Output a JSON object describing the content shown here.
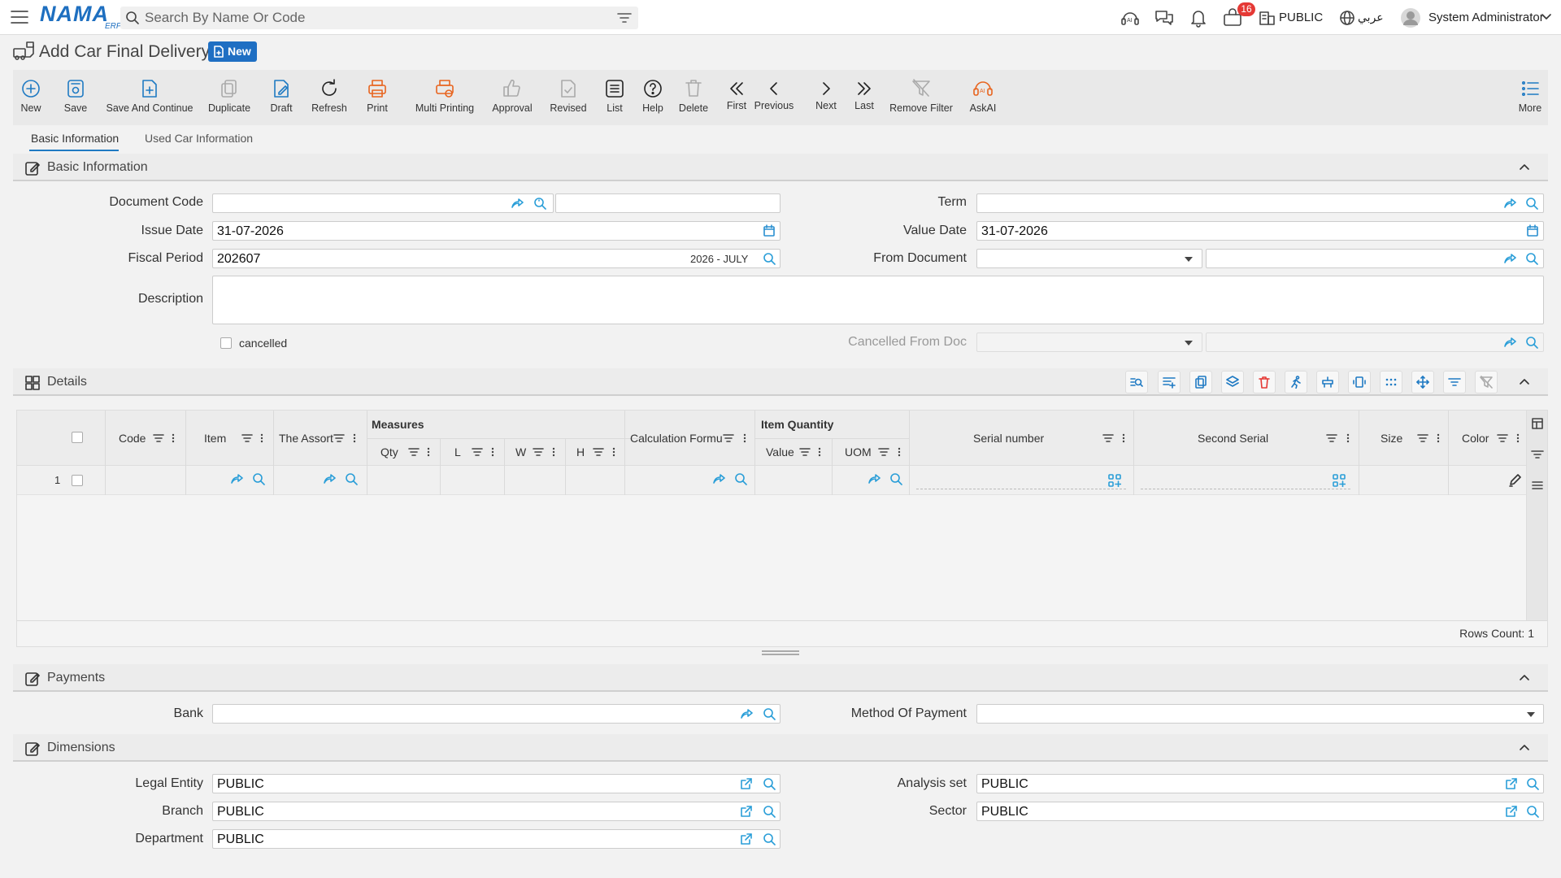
{
  "app": {
    "logo_text": "NAMA",
    "logo_sub": "ERP",
    "search_placeholder": "Search By Name Or Code",
    "notification_count": "16",
    "company": "PUBLIC",
    "language": "عربي",
    "user": "System Administrator"
  },
  "page": {
    "title": "Add Car Final Delivery",
    "status_badge": "New"
  },
  "toolbar": [
    {
      "label": "New",
      "icon": "plus-circle-icon",
      "enabled": true
    },
    {
      "label": "Save",
      "icon": "save-icon",
      "enabled": true
    },
    {
      "label": "Save And Continue",
      "icon": "save-continue-icon",
      "enabled": true
    },
    {
      "label": "Duplicate",
      "icon": "duplicate-icon",
      "enabled": false
    },
    {
      "label": "Draft",
      "icon": "draft-icon",
      "enabled": true
    },
    {
      "label": "Refresh",
      "icon": "refresh-icon",
      "enabled": true
    },
    {
      "label": "Print",
      "icon": "print-icon",
      "enabled": true
    },
    {
      "label": "Multi Printing",
      "icon": "multi-print-icon",
      "enabled": true
    },
    {
      "label": "Approval",
      "icon": "thumbs-up-icon",
      "enabled": false
    },
    {
      "label": "Revised",
      "icon": "revised-icon",
      "enabled": false
    },
    {
      "label": "List",
      "icon": "list-icon",
      "enabled": true
    },
    {
      "label": "Help",
      "icon": "help-icon",
      "enabled": true
    },
    {
      "label": "Delete",
      "icon": "trash-icon",
      "enabled": false
    },
    {
      "label": "First",
      "icon": "first-icon",
      "enabled": true
    },
    {
      "label": "Previous",
      "icon": "previous-icon",
      "enabled": true
    },
    {
      "label": "Next",
      "icon": "next-icon",
      "enabled": true
    },
    {
      "label": "Last",
      "icon": "last-icon",
      "enabled": true
    },
    {
      "label": "Remove Filter",
      "icon": "remove-filter-icon",
      "enabled": false
    },
    {
      "label": "AskAI",
      "icon": "ai-icon",
      "enabled": true
    },
    {
      "label": "More",
      "icon": "more-icon",
      "enabled": true
    }
  ],
  "tabs": [
    "Basic Information",
    "Used Car Information"
  ],
  "sections": {
    "basic": "Basic Information",
    "details": "Details",
    "payments": "Payments",
    "dimensions": "Dimensions"
  },
  "basic_info": {
    "document_code_label": "Document Code",
    "document_code": "",
    "term_label": "Term",
    "term": "",
    "issue_date_label": "Issue Date",
    "issue_date": "31-07-2026",
    "value_date_label": "Value Date",
    "value_date": "31-07-2026",
    "fiscal_period_label": "Fiscal Period",
    "fiscal_period": "202607",
    "fiscal_period_name": "2026 - JULY",
    "from_document_label": "From Document",
    "description_label": "Description",
    "cancelled_label": "cancelled",
    "cancelled_from_doc_label": "Cancelled From Doc"
  },
  "grid": {
    "group_measures": "Measures",
    "group_item_quantity": "Item Quantity",
    "columns": {
      "code": "Code",
      "item": "Item",
      "assort": "The Assort",
      "qty": "Qty",
      "l": "L",
      "w": "W",
      "h": "H",
      "calc": "Calculation Formu",
      "value": "Value",
      "uom": "UOM",
      "serial": "Serial number",
      "second_serial": "Second Serial",
      "size": "Size",
      "color": "Color"
    },
    "rows": [
      {
        "index": "1"
      }
    ],
    "rows_count": "Rows Count: 1"
  },
  "payments": {
    "bank_label": "Bank",
    "method_label": "Method Of Payment"
  },
  "dimensions": {
    "legal_entity_label": "Legal Entity",
    "legal_entity": "PUBLIC",
    "analysis_set_label": "Analysis set",
    "analysis_set": "PUBLIC",
    "branch_label": "Branch",
    "branch": "PUBLIC",
    "sector_label": "Sector",
    "sector": "PUBLIC",
    "department_label": "Department",
    "department": "PUBLIC"
  },
  "colors": {
    "accent": "#1f7ac3",
    "orange": "#e8641e",
    "badge_red": "#e53935"
  }
}
